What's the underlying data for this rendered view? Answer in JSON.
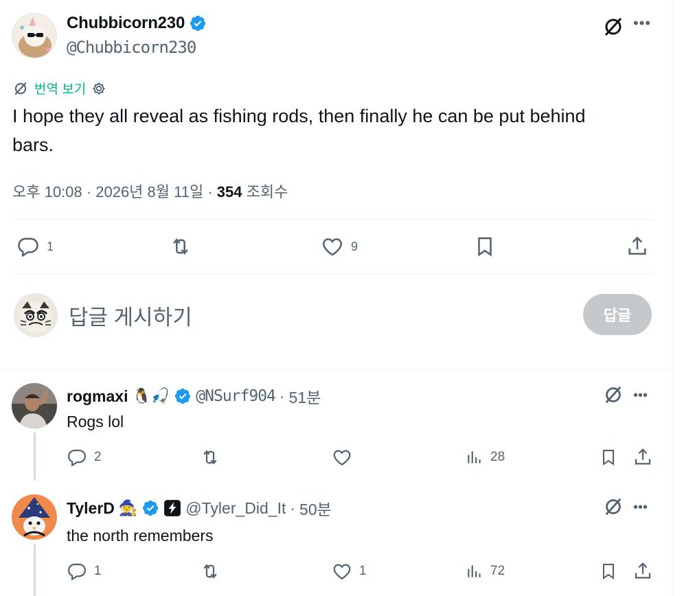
{
  "tweet": {
    "author_name": "Chubbicorn230",
    "author_handle": "@Chubbicorn230",
    "translate_label": "번역 보기",
    "text": "I hope they all reveal as fishing rods, then finally he can be put behind bars.",
    "time": "오후 10:08",
    "date": "2026년 8월 11일",
    "views": "354",
    "views_label": "조회수",
    "sep": "·",
    "actions": {
      "replies": "1",
      "retweets": "",
      "likes": "9"
    }
  },
  "composer": {
    "placeholder": "답글 게시하기",
    "button_label": "답글"
  },
  "replies": [
    {
      "name": "rogmaxi",
      "emojis": "🐧🎣",
      "handle": "@NSurf904",
      "time": "51분",
      "text": "Rogs lol",
      "replies": "2",
      "likes": "",
      "views": "28"
    },
    {
      "name": "TylerD",
      "emojis": "🧙",
      "handle": "@Tyler_Did_It",
      "time": "50분",
      "text": "the north remembers",
      "replies": "1",
      "likes": "1",
      "views": "72"
    }
  ],
  "colors": {
    "verified": "#1d9bf0",
    "translate": "#00ba7c",
    "muted": "#536471",
    "reply_button": "#c6c9cc"
  },
  "icons": [
    "verified-badge-icon",
    "grok-icon",
    "more-icon",
    "gear-icon",
    "reply-icon",
    "retweet-icon",
    "like-icon",
    "bookmark-icon",
    "share-icon",
    "views-icon",
    "automated-icon"
  ]
}
